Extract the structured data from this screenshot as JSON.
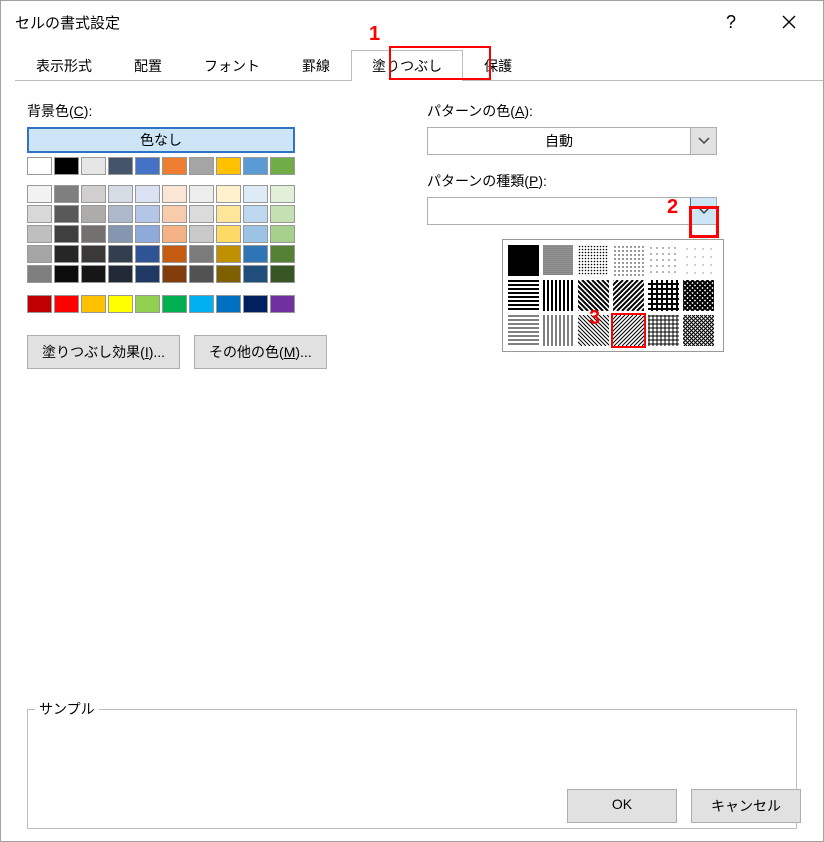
{
  "dialog": {
    "title": "セルの書式設定"
  },
  "tabs": {
    "display": "表示形式",
    "align": "配置",
    "font": "フォント",
    "border": "罫線",
    "fill": "塗りつぶし",
    "protect": "保護"
  },
  "annotations": {
    "n1": "1",
    "n2": "2",
    "n3": "3"
  },
  "fill": {
    "bg_label_pre": "背景色(",
    "bg_label_u": "C",
    "bg_label_post": "):",
    "no_color": "色なし",
    "theme_colors_row1": [
      "#ffffff",
      "#000000",
      "#e7e6e6",
      "#44546a",
      "#4472c4",
      "#ed7d31",
      "#a5a5a5",
      "#ffc000",
      "#5b9bd5",
      "#70ad47"
    ],
    "theme_shades": [
      [
        "#f2f2f2",
        "#7f7f7f",
        "#d0cece",
        "#d6dce4",
        "#d9e1f2",
        "#fbe5d5",
        "#ededed",
        "#fff2cc",
        "#deebf6",
        "#e2efd9"
      ],
      [
        "#d8d8d8",
        "#595959",
        "#aeabab",
        "#adb9ca",
        "#b4c6e7",
        "#f7cbac",
        "#dbdbdb",
        "#fee599",
        "#bdd7ee",
        "#c5e0b3"
      ],
      [
        "#bfbfbf",
        "#3f3f3f",
        "#757070",
        "#8496b0",
        "#8eaadb",
        "#f4b183",
        "#c9c9c9",
        "#ffd965",
        "#9cc3e5",
        "#a8d08d"
      ],
      [
        "#a5a5a5",
        "#262626",
        "#3a3838",
        "#323f4f",
        "#2f5496",
        "#c55a11",
        "#7b7b7b",
        "#bf9000",
        "#2e75b5",
        "#538135"
      ],
      [
        "#7f7f7f",
        "#0c0c0c",
        "#171616",
        "#222a35",
        "#1f3864",
        "#833c0b",
        "#525252",
        "#7f6000",
        "#1e4e79",
        "#375623"
      ]
    ],
    "standard_colors": [
      "#c00000",
      "#ff0000",
      "#ffc000",
      "#ffff00",
      "#92d050",
      "#00b050",
      "#00b0f0",
      "#0070c0",
      "#002060",
      "#7030a0"
    ],
    "effects_btn_pre": "塗りつぶし効果(",
    "effects_btn_u": "I",
    "effects_btn_post": ")...",
    "more_btn_pre": "その他の色(",
    "more_btn_u": "M",
    "more_btn_post": ")..."
  },
  "pattern": {
    "color_label_pre": "パターンの色(",
    "color_label_u": "A",
    "color_label_post": "):",
    "auto_text": "自動",
    "type_label_pre": "パターンの種類(",
    "type_label_u": "P",
    "type_label_post": "):"
  },
  "sample": {
    "label": "サンプル"
  },
  "buttons": {
    "ok": "OK",
    "cancel": "キャンセル"
  }
}
